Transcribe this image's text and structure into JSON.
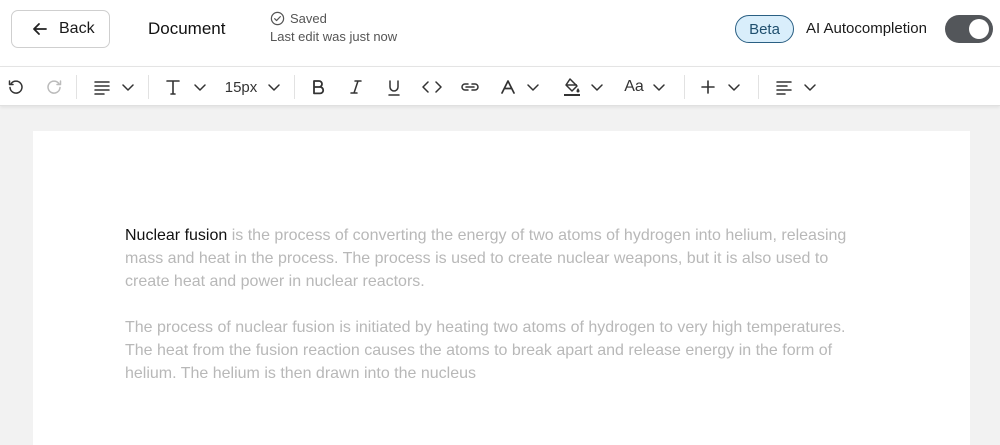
{
  "header": {
    "back_label": "Back",
    "doc_title": "Document",
    "status": "Saved",
    "last_edit": "Last edit was just now",
    "beta_badge": "Beta",
    "ai_label": "AI Autocompletion",
    "ai_enabled": true
  },
  "toolbar": {
    "font_size": "15px",
    "case_label": "Aa",
    "icons": [
      "undo-icon",
      "redo-icon",
      "paragraph-icon",
      "text-type-icon",
      "bold-icon",
      "italic-icon",
      "underline-icon",
      "code-icon",
      "link-icon",
      "text-color-icon",
      "highlight-icon",
      "case-icon",
      "insert-icon",
      "align-icon"
    ]
  },
  "document": {
    "p1_accepted": "Nuclear fusion",
    "p1_suggestion": " is the process of converting the energy of two atoms of hydrogen into helium, releasing mass and heat in the process. The process is used to create nuclear weapons, but it is also used to create heat and power in nuclear reactors.",
    "p2_suggestion": "The process of nuclear fusion is initiated by heating two atoms of hydrogen to very high temperatures. The heat from the fusion reaction causes the atoms to break apart and release energy in the form of helium. The helium is then drawn into the nucleus"
  },
  "colors": {
    "accent": "#2a5f83",
    "beta_bg": "#d9eefb",
    "toggle_on": "#53565a",
    "suggestion_text": "#b8b8b8"
  }
}
